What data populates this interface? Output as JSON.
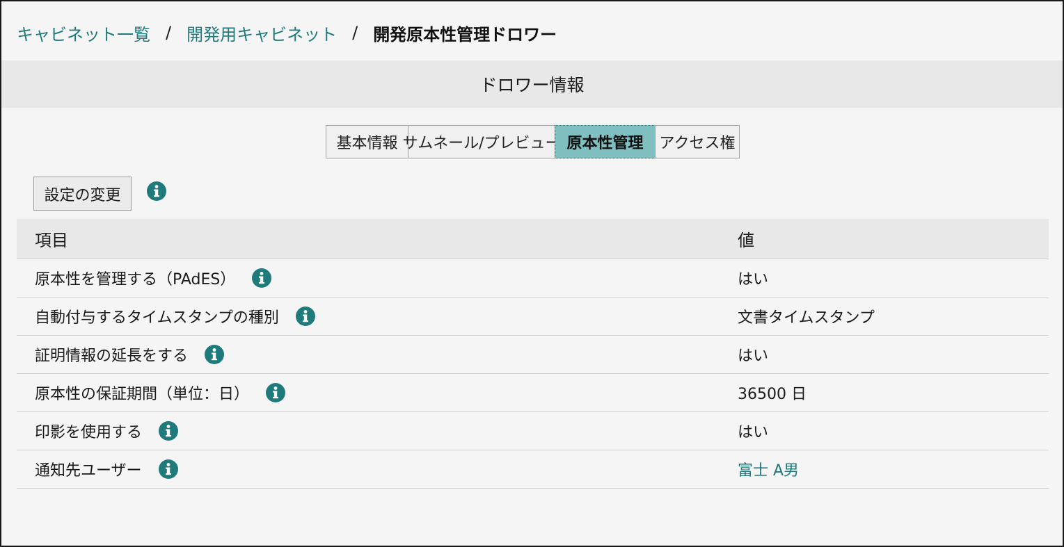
{
  "breadcrumb": {
    "items": [
      "キャビネット一覧",
      "開発用キャビネット"
    ],
    "separator": "/",
    "current": "開発原本性管理ドロワー"
  },
  "section": {
    "title": "ドロワー情報"
  },
  "tabs": [
    {
      "label": "基本情報",
      "active": false
    },
    {
      "label": "サムネール/プレビュー",
      "active": false
    },
    {
      "label": "原本性管理",
      "active": true
    },
    {
      "label": "アクセス権",
      "active": false
    }
  ],
  "actions": {
    "change_settings_label": "設定の変更"
  },
  "table": {
    "headers": {
      "name": "項目",
      "value": "値"
    },
    "rows": [
      {
        "name": "原本性を管理する（PAdES）",
        "value": "はい"
      },
      {
        "name": "自動付与するタイムスタンプの種別",
        "value": "文書タイムスタンプ"
      },
      {
        "name": "証明情報の延長をする",
        "value": "はい"
      },
      {
        "name": "原本性の保証期間（単位：日）",
        "value": "36500 日"
      },
      {
        "name": "印影を使用する",
        "value": "はい"
      },
      {
        "name": "通知先ユーザー",
        "value": "富士 A男"
      }
    ]
  },
  "icons": {
    "info": "info-icon"
  },
  "colors": {
    "accent": "#1f7a7c",
    "tab_active": "#7fbfc0",
    "header_bg": "#e8e8e8",
    "page_bg": "#f5f5f5"
  }
}
